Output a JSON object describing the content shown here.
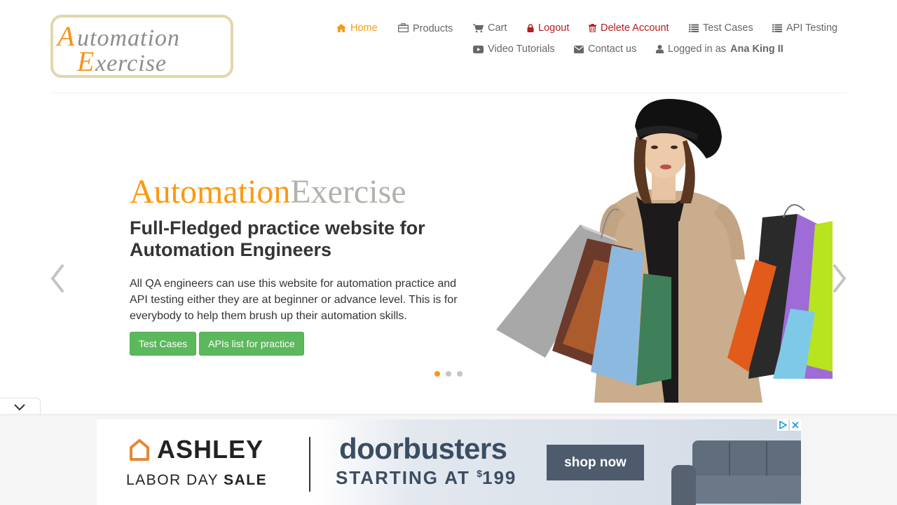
{
  "header": {
    "logo": {
      "line1": "Automation",
      "line2": "Exercise"
    },
    "nav": {
      "home": "Home",
      "products": "Products",
      "cart": "Cart",
      "logout": "Logout",
      "delete_account": "Delete Account",
      "test_cases": "Test Cases",
      "api_testing": "API Testing",
      "video_tutorials": "Video Tutorials",
      "contact_us": "Contact us",
      "logged_in_prefix": "Logged in as",
      "username": "Ana King II"
    }
  },
  "slider": {
    "brand_part1": "Automation",
    "brand_part2": "Exercise",
    "headline": "Full-Fledged practice website for Automation Engineers",
    "description": "All QA engineers can use this website for automation practice and API testing either they are at beginner or advance level. This is for everybody to help them brush up their automation skills.",
    "buttons": {
      "test_cases": "Test Cases",
      "apis_list": "APIs list for practice"
    },
    "active_slide": 1,
    "slide_count": 3
  },
  "ad": {
    "brand": "ASHLEY",
    "labor_day": "LABOR DAY",
    "sale": "SALE",
    "headline": "doorbusters",
    "starting_at": "STARTING AT",
    "price_symbol": "$",
    "price": "199",
    "cta": "shop now"
  },
  "colors": {
    "accent": "#fe980f",
    "danger": "#b31e1e",
    "button_green": "#5cb85c",
    "text": "#696763",
    "heading": "#363432"
  }
}
